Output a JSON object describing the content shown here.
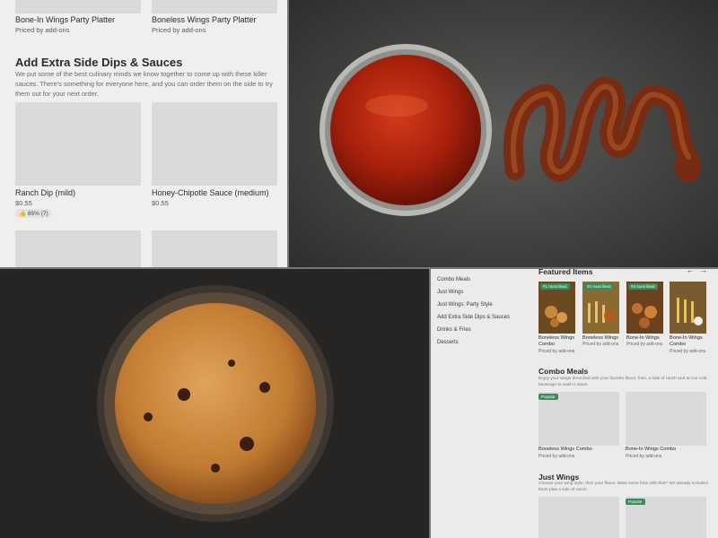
{
  "top_left": {
    "items_top": [
      {
        "name": "Bone-In Wings Party Platter",
        "sub": "Priced by add-ons"
      },
      {
        "name": "Boneless Wings Party Platter",
        "sub": "Priced by add-ons"
      }
    ],
    "section_title": "Add Extra Side Dips & Sauces",
    "section_desc": "We put some of the best culinary minds we know together to come up with these killer sauces. There's something for everyone here, and you can order them on the side to try them out for your next order.",
    "items": [
      {
        "name": "Ranch Dip (mild)",
        "price": "$0.55",
        "rating": "85% (7)"
      },
      {
        "name": "Honey-Chipotle Sauce (medium)",
        "price": "$0.55"
      }
    ]
  },
  "bottom_right": {
    "nav": [
      "Combo Meals",
      "Just Wings",
      "Just Wings: Party Style",
      "Add Extra Side Dips & Sauces",
      "Drinks & Fries",
      "Desserts"
    ],
    "featured_title": "Featured Items",
    "featured": [
      {
        "badge": "#1 most liked",
        "name": "Boneless Wings Combo",
        "sub": "Priced by add-ons"
      },
      {
        "badge": "#2 most liked",
        "name": "Boneless Wings",
        "sub": "Priced by add-ons"
      },
      {
        "badge": "#3 most liked",
        "name": "Bone-In Wings",
        "sub": "Priced by add-ons"
      },
      {
        "badge": "",
        "name": "Bone-In Wings Combo",
        "sub": "Priced by add-ons"
      }
    ],
    "combo_title": "Combo Meals",
    "combo_desc": "Enjoy your wings drenched with your favorite flavor, fries, a side of ranch and an ice cold beverage to wash it down.",
    "combo_items": [
      {
        "badge": "Popular",
        "name": "Boneless Wings Combo",
        "sub": "Priced by add-ons"
      },
      {
        "badge": "",
        "name": "Bone-In Wings Combo",
        "sub": "Priced by add-ons"
      }
    ],
    "wings_title": "Just Wings",
    "wings_desc": "Choose your wing style, then your flavor. Want some fries with that? We already included them plus a side of ranch.",
    "wings_badge": "Popular",
    "arrows": {
      "prev": "←",
      "next": "→"
    }
  },
  "colors": {
    "badge_green": "#3a8a5a",
    "placeholder": "#dadada"
  }
}
